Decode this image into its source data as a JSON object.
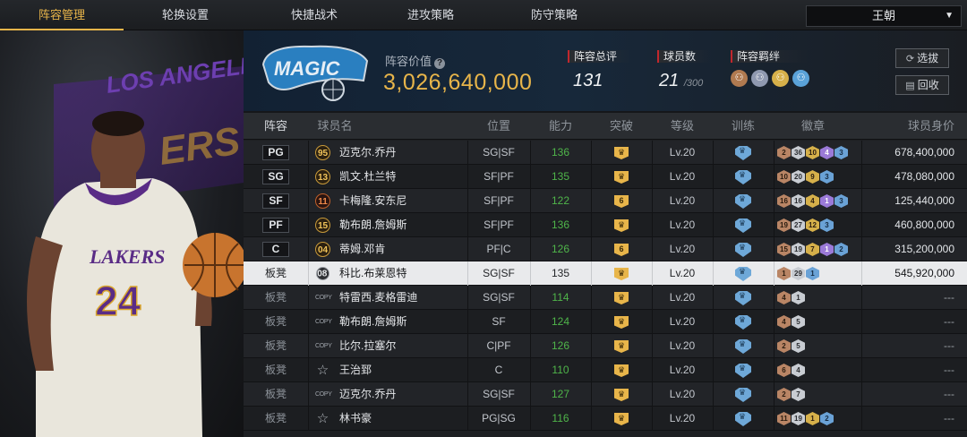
{
  "nav": {
    "tabs": [
      "阵容管理",
      "轮换设置",
      "快捷战术",
      "进攻策略",
      "防守策略"
    ],
    "active_tab": 0,
    "team_select": "王朝"
  },
  "hero": {
    "jersey_team": "LAKERS",
    "jersey_number": "24",
    "bg_text": "LOS ANGELES LAKERS"
  },
  "banner": {
    "logo_text": "MAGIC",
    "value_label": "阵容价值",
    "value": "3,026,640,000",
    "overall_label": "阵容总评",
    "overall": "131",
    "players_label": "球员数",
    "players": "21",
    "players_max": "/300",
    "bonds_label": "阵容羁绊",
    "btn_select": "选拔",
    "btn_recycle": "回收"
  },
  "columns": [
    "阵容",
    "球员名",
    "位置",
    "能力",
    "突破",
    "等级",
    "训练",
    "徽章",
    "球员身价"
  ],
  "rows": [
    {
      "slot": "PG",
      "bench": false,
      "num": "95",
      "num_style": "gold",
      "name": "迈克尔.乔丹",
      "pos": "SG|SF",
      "rating": "136",
      "break": "♛",
      "level": "Lv.20",
      "badges": [
        [
          "2",
          "bronze"
        ],
        [
          "36",
          "silver"
        ],
        [
          "10",
          "gold"
        ],
        [
          "4",
          "purple"
        ],
        [
          "3",
          "blue"
        ]
      ],
      "salary": "678,400,000"
    },
    {
      "slot": "SG",
      "bench": false,
      "num": "13",
      "num_style": "gold",
      "name": "凯文.杜兰特",
      "pos": "SF|PF",
      "rating": "135",
      "break": "♛",
      "level": "Lv.20",
      "badges": [
        [
          "10",
          "bronze"
        ],
        [
          "20",
          "silver"
        ],
        [
          "9",
          "gold"
        ],
        [
          "3",
          "blue"
        ]
      ],
      "salary": "478,080,000"
    },
    {
      "slot": "SF",
      "bench": false,
      "num": "11",
      "num_style": "red",
      "name": "卡梅隆.安东尼",
      "pos": "SF|PF",
      "rating": "122",
      "break": "6",
      "level": "Lv.20",
      "badges": [
        [
          "16",
          "bronze"
        ],
        [
          "16",
          "silver"
        ],
        [
          "4",
          "gold"
        ],
        [
          "1",
          "purple"
        ],
        [
          "3",
          "blue"
        ]
      ],
      "salary": "125,440,000"
    },
    {
      "slot": "PF",
      "bench": false,
      "num": "15",
      "num_style": "gold",
      "name": "勒布朗.詹姆斯",
      "pos": "SF|PF",
      "rating": "136",
      "break": "♛",
      "level": "Lv.20",
      "badges": [
        [
          "19",
          "bronze"
        ],
        [
          "27",
          "silver"
        ],
        [
          "12",
          "gold"
        ],
        [
          "3",
          "blue"
        ]
      ],
      "salary": "460,800,000"
    },
    {
      "slot": "C",
      "bench": false,
      "num": "04",
      "num_style": "gold",
      "name": "蒂姆.邓肯",
      "pos": "PF|C",
      "rating": "126",
      "break": "6",
      "level": "Lv.20",
      "badges": [
        [
          "15",
          "bronze"
        ],
        [
          "19",
          "silver"
        ],
        [
          "7",
          "gold"
        ],
        [
          "1",
          "purple"
        ],
        [
          "2",
          "blue"
        ]
      ],
      "salary": "315,200,000"
    },
    {
      "slot": "板凳",
      "bench": true,
      "num": "08",
      "num_style": "dark",
      "name": "科比.布莱恩特",
      "pos": "SG|SF",
      "rating": "135",
      "break": "♛",
      "level": "Lv.20",
      "badges": [
        [
          "1",
          "bronze"
        ],
        [
          "29",
          "silver"
        ],
        [
          "1",
          "blue"
        ]
      ],
      "salary": "545,920,000",
      "selected": true
    },
    {
      "slot": "板凳",
      "bench": true,
      "num": "COPY",
      "num_style": "copy",
      "name": "特雷西.麦格雷迪",
      "pos": "SG|SF",
      "rating": "114",
      "break": "♛",
      "level": "Lv.20",
      "badges": [
        [
          "4",
          "bronze"
        ],
        [
          "1",
          "silver"
        ]
      ],
      "salary": "---"
    },
    {
      "slot": "板凳",
      "bench": true,
      "num": "COPY",
      "num_style": "copy",
      "name": "勒布朗.詹姆斯",
      "pos": "SF",
      "rating": "124",
      "break": "♛",
      "level": "Lv.20",
      "badges": [
        [
          "4",
          "bronze"
        ],
        [
          "5",
          "silver"
        ]
      ],
      "salary": "---"
    },
    {
      "slot": "板凳",
      "bench": true,
      "num": "COPY",
      "num_style": "copy",
      "name": "比尔.拉塞尔",
      "pos": "C|PF",
      "rating": "126",
      "break": "♛",
      "level": "Lv.20",
      "badges": [
        [
          "2",
          "bronze"
        ],
        [
          "5",
          "silver"
        ]
      ],
      "salary": "---"
    },
    {
      "slot": "板凳",
      "bench": true,
      "num": "☆",
      "num_style": "star",
      "name": "王治郅",
      "pos": "C",
      "rating": "110",
      "break": "♛",
      "level": "Lv.20",
      "badges": [
        [
          "6",
          "bronze"
        ],
        [
          "4",
          "silver"
        ]
      ],
      "salary": "---"
    },
    {
      "slot": "板凳",
      "bench": true,
      "num": "COPY",
      "num_style": "copy",
      "name": "迈克尔.乔丹",
      "pos": "SG|SF",
      "rating": "127",
      "break": "♛",
      "level": "Lv.20",
      "badges": [
        [
          "2",
          "bronze"
        ],
        [
          "7",
          "silver"
        ]
      ],
      "salary": "---"
    },
    {
      "slot": "板凳",
      "bench": true,
      "num": "☆",
      "num_style": "star",
      "name": "林书豪",
      "pos": "PG|SG",
      "rating": "116",
      "break": "♛",
      "level": "Lv.20",
      "badges": [
        [
          "11",
          "bronze"
        ],
        [
          "19",
          "silver"
        ],
        [
          "1",
          "gold"
        ],
        [
          "2",
          "blue"
        ]
      ],
      "salary": "---"
    }
  ]
}
